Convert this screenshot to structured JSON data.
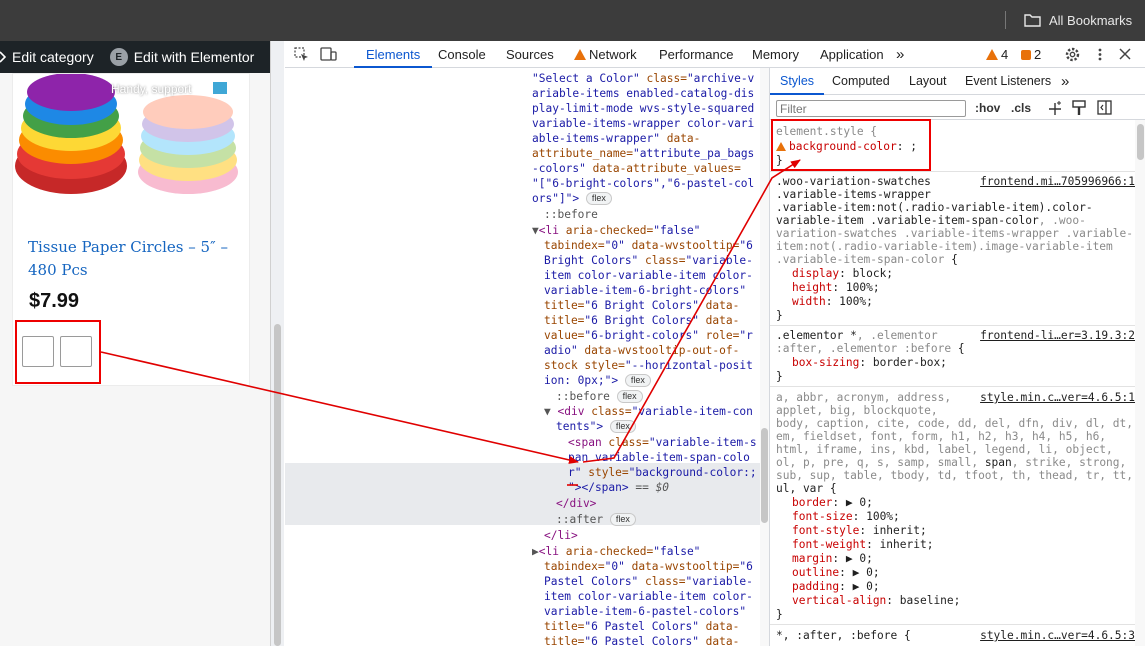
{
  "browser": {
    "bookmarks_label": "All Bookmarks"
  },
  "admin_bar": {
    "edit_category": "Edit category",
    "edit_with_elementor": "Edit with Elementor",
    "elementor_badge": "E"
  },
  "product": {
    "promo_text": "Handy, support",
    "title": "Tissue Paper Circles – 5″ – 480 Pcs",
    "price": "$7.99"
  },
  "devtools": {
    "tabs": [
      "Elements",
      "Console",
      "Sources",
      "Network",
      "Performance",
      "Memory",
      "Application"
    ],
    "more_tabs": "»",
    "warnings_count": "4",
    "issues_count": "2",
    "elements_tree": {
      "l1": "\"Select a Color\"",
      "l1_attr": " class=",
      "l1_val": "\"archive-v",
      "l2": "ariable-items enabled-catalog-dis",
      "l3": "play-limit-mode wvs-style-squared",
      "l4": "variable-items-wrapper color-vari",
      "l5": "able-items-wrapper\"",
      "l5b": " data-",
      "l6": "attribute_name=",
      "l6b": "\"attribute_pa_bags",
      "l7": "-colors\"",
      "l7b": " data-attribute_values=",
      "l8": "\"[\"6-bright-colors\",\"6-pastel-col",
      "l9": "ors\"]\">",
      "before": "::before",
      "li1_open": "<li",
      "li1_a": " aria-checked=",
      "li1_v": "\"false\"",
      "li1_2a": "tabindex=",
      "li1_2v": "\"0\"",
      "li1_2b": " data-wvstooltip=",
      "li1_2c": "\"6",
      "li1_3": "Bright Colors\"",
      "li1_3b": " class=",
      "li1_3c": "\"variable-",
      "li1_4": "item color-variable-item color-",
      "li1_5": "variable-item-6-bright-colors\"",
      "li1_6a": "title=",
      "li1_6v": "\"6 Bright Colors\"",
      "li1_6b": " data-",
      "li1_7a": "title=",
      "li1_7v": "\"6 Bright Colors\"",
      "li1_7b": " data-",
      "li1_8a": "value=",
      "li1_8v": "\"6-bright-colors\"",
      "li1_8b": " role=",
      "li1_8c": "\"r",
      "li1_9": "adio\"",
      "li1_9b": " data-wvstooltip-out-of-",
      "li1_10a": "stock",
      "li1_10b": " style=",
      "li1_10c": "\"--horizontal-posit",
      "li1_11": "ion: 0px;\">",
      "div_open": "<div",
      "div_a": " class=",
      "div_v": "\"variable-item-con",
      "div_2": "tents\">",
      "span_open": "<span",
      "span_a": " class=",
      "span_v": "\"variable-item-s",
      "span_2": "pan variable-item-span-colo",
      "span_3a": "r\"",
      "span_3b": " style=",
      "span_3c": "\"background-color:;",
      "span_4": "\"></span>",
      "span_4b": " == $0",
      "div_close": "</div>",
      "after": "::after",
      "li_close": "</li>",
      "li2_open": "<li",
      "li2_a": " aria-checked=",
      "li2_v": "\"false\"",
      "li2_2a": "tabindex=",
      "li2_2v": "\"0\"",
      "li2_2b": " data-wvstooltip=",
      "li2_2c": "\"6",
      "li2_3": "Pastel Colors\"",
      "li2_3b": " class=",
      "li2_3c": "\"variable-",
      "li2_4": "item color-variable-item color-",
      "li2_5": "variable-item-6-pastel-colors\"",
      "li2_6a": "title=",
      "li2_6v": "\"6 Pastel Colors\"",
      "li2_6b": " data-",
      "li2_7a": "title=",
      "li2_7v": "\"6 Pastel Colors\"",
      "li2_7b": " data-",
      "flex_badge": "flex"
    },
    "styles": {
      "tabs": [
        "Styles",
        "Computed",
        "Layout",
        "Event Listeners"
      ],
      "more_tabs": "»",
      "filter_placeholder": "Filter",
      "hov": ":hov",
      "cls": ".cls",
      "rule1": {
        "selector": "element.style {",
        "prop": "background-color",
        "value": ": ;",
        "close": "}"
      },
      "rule2": {
        "source": "frontend.mi…705996966:1",
        "s1": ".woo-variation-swatches",
        "s2": ".variable-items-wrapper",
        "s3": ".variable-item:not(.radio-variable-item).color-",
        "s4a": "variable-item .variable-item-span-color",
        "s4b": ", .woo-",
        "s5": "variation-swatches .variable-items-wrapper .variable-",
        "s6": "item:not(.radio-variable-item).image-variable-item",
        "s7": ".variable-item-span-color",
        "s7b": " {",
        "p1": "display",
        "v1": ": block;",
        "p2": "height",
        "v2": ": 100%;",
        "p3": "width",
        "v3": ": 100%;",
        "close": "}"
      },
      "rule3": {
        "source": "frontend-li…er=3.19.3:2",
        "s1a": ".elementor *",
        "s1b": ", .elementor",
        "s2a": ":after, .elementor :before",
        "s2b": " {",
        "p1": "box-sizing",
        "v1": ": border-box;",
        "close": "}"
      },
      "rule4": {
        "source": "style.min.c…ver=4.6.5:1",
        "s1": "a, abbr, acronym, address,",
        "s2": "applet, big, blockquote,",
        "s3": "body, caption, cite, code, dd, del, dfn, div, dl, dt,",
        "s4": "em, fieldset, font, form, h1, h2, h3, h4, h5, h6,",
        "s5": "html, iframe, ins, kbd, label, legend, li, object,",
        "s6a": "ol, p, pre, q, s, samp, small, ",
        "s6b": "span",
        "s6c": ", strike, strong,",
        "s7": "sub, sup, table, tbody, td, tfoot, th, thead, tr, tt,",
        "s8": "ul, var {",
        "p1": "border",
        "v1": ": ▶ 0;",
        "p2": "font-size",
        "v2": ": 100%;",
        "p3": "font-style",
        "v3": ": inherit;",
        "p4": "font-weight",
        "v4": ": inherit;",
        "p5": "margin",
        "v5": ": ▶ 0;",
        "p6": "outline",
        "v6": ": ▶ 0;",
        "p7": "padding",
        "v7": ": ▶ 0;",
        "p8": "vertical-align",
        "v8": ": baseline;",
        "close": "}"
      },
      "rule5": {
        "source": "style.min.c…ver=4.6.5:3",
        "s1": "*, :after, :before {"
      }
    }
  },
  "colors": {
    "annotation": "#e00000",
    "accent": "#0b57d0",
    "link_blue": "#1565c0"
  }
}
